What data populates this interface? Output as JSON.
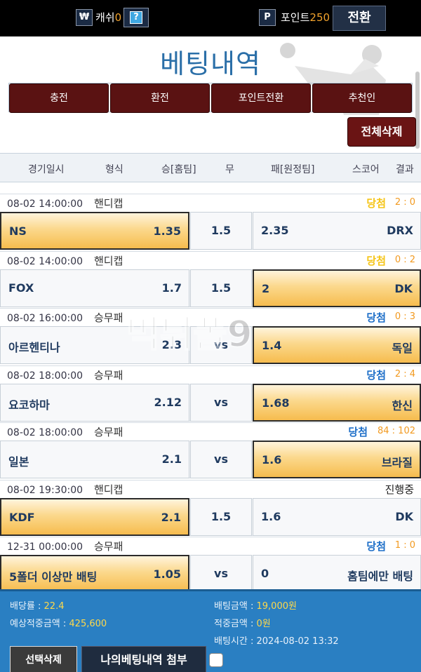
{
  "topbar": {
    "won_icon": "₩",
    "cash_label": "캐쉬",
    "cash_value": "0",
    "help_icon": "?",
    "point_icon": "P",
    "point_label": "포인트",
    "point_value": "250",
    "convert_label": "전환"
  },
  "page_title": "베팅내역",
  "nav": [
    "충전",
    "환전",
    "포인트전환",
    "추천인"
  ],
  "delete_all_label": "전체삭제",
  "columns": {
    "date": "경기일시",
    "type": "형식",
    "home": "승[홈팀]",
    "draw": "무",
    "away": "패[원정팀]",
    "score": "스코어",
    "result": "결과"
  },
  "bets": [
    {
      "date": "08-02  14:00:00",
      "type": "핸디캡",
      "result": "당첨",
      "result_color": "yellow",
      "score": "2 : 0",
      "home": "NS",
      "home_odd": "1.35",
      "draw": "1.5",
      "away_odd": "2.35",
      "away": "DRX",
      "selected": "home"
    },
    {
      "date": "08-02  14:00:00",
      "type": "핸디캡",
      "result": "당첨",
      "result_color": "yellow",
      "score": "0 : 2",
      "home": "FOX",
      "home_odd": "1.7",
      "draw": "1.5",
      "away_odd": "2",
      "away": "DK",
      "selected": "away"
    },
    {
      "date": "08-02  16:00:00",
      "type": "승무패",
      "result": "당첨",
      "result_color": "blue",
      "score": "0 : 3",
      "home": "아르헨티나",
      "home_odd": "2.3",
      "draw": "vs",
      "away_odd": "1.4",
      "away": "독일",
      "selected": "away"
    },
    {
      "date": "08-02  18:00:00",
      "type": "승무패",
      "result": "당첨",
      "result_color": "blue",
      "score": "2 : 4",
      "home": "요코하마",
      "home_odd": "2.12",
      "draw": "vs",
      "away_odd": "1.68",
      "away": "한신",
      "selected": "away"
    },
    {
      "date": "08-02  18:00:00",
      "type": "승무패",
      "result": "당첨",
      "result_color": "blue",
      "score": "84 : 102",
      "home": "일본",
      "home_odd": "2.1",
      "draw": "vs",
      "away_odd": "1.6",
      "away": "브라질",
      "selected": "away"
    },
    {
      "date": "08-02  19:30:00",
      "type": "핸디캡",
      "result": "진행중",
      "result_color": "plain",
      "score": "",
      "home": "KDF",
      "home_odd": "2.1",
      "draw": "1.5",
      "away_odd": "1.6",
      "away": "DK",
      "selected": "home"
    },
    {
      "date": "12-31  00:00:00",
      "type": "승무패",
      "result": "당첨",
      "result_color": "blue",
      "score": "1 : 0",
      "home": "5폴더 이상만 배팅",
      "home_odd": "1.05",
      "draw": "vs",
      "away_odd": "0",
      "away": "홈팀에만 배팅",
      "selected": "home"
    }
  ],
  "summary": {
    "rate_label": "배당률 : ",
    "rate_value": "22.4",
    "expected_label": "예상적중금액 : ",
    "expected_value": "425,600",
    "bet_amount_label": "배팅금액 : ",
    "bet_amount_value": "19,000원",
    "hit_amount_label": "적중금액 : ",
    "hit_amount_value": "0원",
    "bet_time_label": "배팅시간 : ",
    "bet_time_value": "2024-08-02 13:32",
    "select_delete_label": "선택삭제",
    "attach_label": "나의베팅내역 첨부"
  },
  "watermark_text": "먹튀폴9",
  "colors": {
    "accent": "#2a7fc2",
    "nav_bg": "#5a1212",
    "selected_cell": "#f6bc4e",
    "win_yellow": "#f5c518",
    "win_blue": "#1e6fc8"
  }
}
